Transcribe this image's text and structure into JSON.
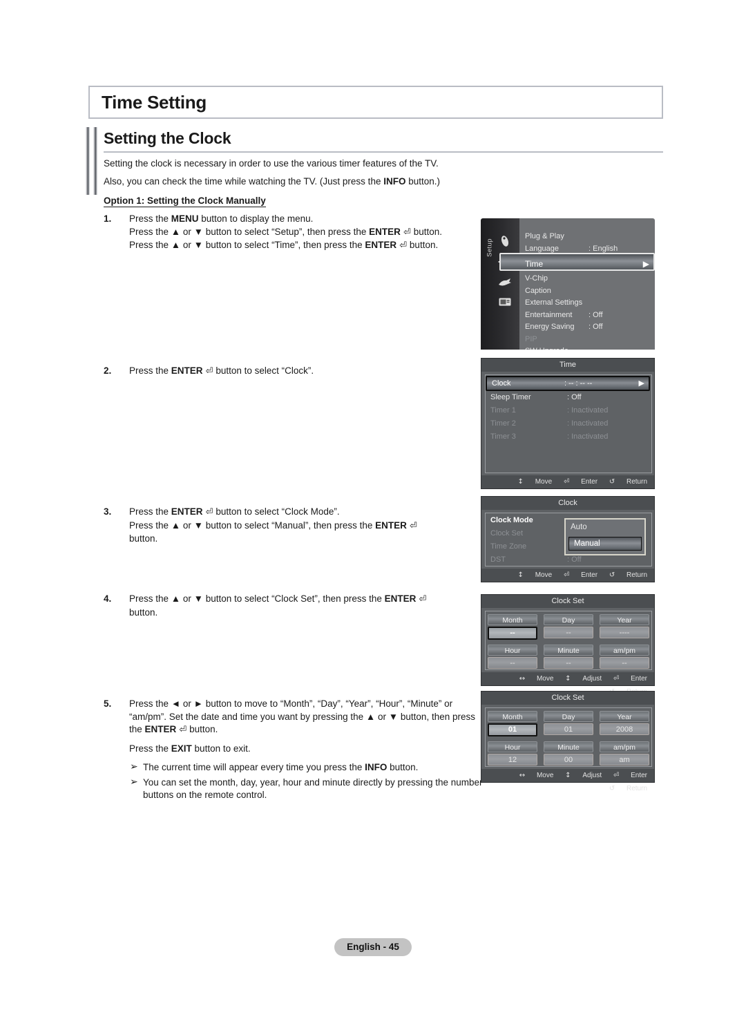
{
  "page": {
    "chapter_title": "Time Setting",
    "section_title": "Setting the Clock",
    "intro_line1": "Setting the clock is necessary in order to use the various timer features of the TV.",
    "intro_line2_a": "Also, you can check the time while watching the TV. (Just press the ",
    "intro_line2_b": "INFO",
    "intro_line2_c": " button.)",
    "option_heading": "Option 1: Setting the Clock Manually",
    "footer": "English - 45"
  },
  "steps": {
    "s1": {
      "num": "1.",
      "l1_a": "Press the ",
      "l1_b": "MENU",
      "l1_c": " button to display the menu.",
      "l2_a": "Press the ▲ or ▼ button to select “Setup”, then press the ",
      "l2_b": "ENTER",
      "l2_c": " button.",
      "l3_a": "Press the ▲ or ▼ button to select “Time”, then press the ",
      "l3_b": "ENTER",
      "l3_c": " button."
    },
    "s2": {
      "num": "2.",
      "l1_a": "Press the ",
      "l1_b": "ENTER",
      "l1_c": " button to select “Clock”."
    },
    "s3": {
      "num": "3.",
      "l1_a": "Press the ",
      "l1_b": "ENTER",
      "l1_c": " button to select “Clock Mode”.",
      "l2_a": "Press the ▲ or ▼ button to select “Manual”, then press the ",
      "l2_b": "ENTER",
      "l3": "button."
    },
    "s4": {
      "num": "4.",
      "l1_a": "Press the ▲ or ▼ button to select “Clock Set”, then press the ",
      "l1_b": "ENTER",
      "l2": "button."
    },
    "s5": {
      "num": "5.",
      "l1": "Press the ◄ or ► button to move to “Month”, “Day”, “Year”, “Hour”, “Minute” or “am/pm”. Set the date and time you want by pressing the ▲ or ▼ button, then press the ",
      "l1_b": "ENTER",
      "l1_c": " button.",
      "l2_a": "Press the ",
      "l2_b": "EXIT",
      "l2_c": " button to exit.",
      "bullet1_a": "The current time will appear every time you press the ",
      "bullet1_b": "INFO",
      "bullet1_c": " button.",
      "bullet2": "You can set the month, day, year, hour and minute directly by pressing the number buttons on the remote control.",
      "bullet_glyph": "➢"
    }
  },
  "osd": {
    "setup_menu": {
      "rail_label": "Setup",
      "items": [
        {
          "label": "Plug & Play",
          "value": "",
          "state": "normal"
        },
        {
          "label": "Language",
          "value": ": English",
          "state": "normal"
        },
        {
          "label": "Time",
          "value": "",
          "state": "selected",
          "caret": "▶"
        },
        {
          "label": "V-Chip",
          "value": "",
          "state": "normal"
        },
        {
          "label": "Caption",
          "value": "",
          "state": "normal"
        },
        {
          "label": "External Settings",
          "value": "",
          "state": "normal"
        },
        {
          "label": "Entertainment",
          "value": ": Off",
          "state": "normal"
        },
        {
          "label": "Energy Saving",
          "value": ": Off",
          "state": "normal"
        },
        {
          "label": "PIP",
          "value": "",
          "state": "dim"
        },
        {
          "label": "SW Upgrade",
          "value": "",
          "state": "normal"
        }
      ]
    },
    "time_menu": {
      "header": "Time",
      "rows": [
        {
          "label": "Clock",
          "value": ": -- : -- --",
          "state": "selected",
          "caret": "▶"
        },
        {
          "label": "Sleep Timer",
          "value": ": Off",
          "state": "normal"
        },
        {
          "label": "Timer 1",
          "value": ": Inactivated",
          "state": "dim"
        },
        {
          "label": "Timer 2",
          "value": ": Inactivated",
          "state": "dim"
        },
        {
          "label": "Timer 3",
          "value": ": Inactivated",
          "state": "dim"
        }
      ],
      "footer": [
        {
          "icon": "↕",
          "label": "Move"
        },
        {
          "icon": "⏎",
          "label": "Enter"
        },
        {
          "icon": "↺",
          "label": "Return"
        }
      ]
    },
    "clock_menu": {
      "header": "Clock",
      "rows": [
        {
          "label": "Clock Mode",
          "value": ":",
          "state": "normal"
        },
        {
          "label": "Clock Set",
          "value": "",
          "state": "dim"
        },
        {
          "label": "Time Zone",
          "value": "",
          "state": "dim"
        },
        {
          "label": "DST",
          "value": ": Off",
          "state": "dim"
        }
      ],
      "dropdown": {
        "options": [
          "Auto",
          "Manual"
        ],
        "selected": "Manual"
      },
      "footer": [
        {
          "icon": "↕",
          "label": "Move"
        },
        {
          "icon": "⏎",
          "label": "Enter"
        },
        {
          "icon": "↺",
          "label": "Return"
        }
      ]
    },
    "clock_set_empty": {
      "header": "Clock Set",
      "fields": [
        {
          "label": "Month",
          "value": "--",
          "focused": true
        },
        {
          "label": "Day",
          "value": "--",
          "focused": false
        },
        {
          "label": "Year",
          "value": "----",
          "focused": false
        },
        {
          "label": "Hour",
          "value": "--",
          "focused": false
        },
        {
          "label": "Minute",
          "value": "--",
          "focused": false
        },
        {
          "label": "am/pm",
          "value": "--",
          "focused": false
        }
      ],
      "footer": [
        {
          "icon": "↔",
          "label": "Move"
        },
        {
          "icon": "↕",
          "label": "Adjust"
        },
        {
          "icon": "⏎",
          "label": "Enter"
        },
        {
          "icon": "↺",
          "label": "Return"
        }
      ]
    },
    "clock_set_filled": {
      "header": "Clock Set",
      "fields": [
        {
          "label": "Month",
          "value": "01",
          "focused": true
        },
        {
          "label": "Day",
          "value": "01",
          "focused": false
        },
        {
          "label": "Year",
          "value": "2008",
          "focused": false
        },
        {
          "label": "Hour",
          "value": "12",
          "focused": false
        },
        {
          "label": "Minute",
          "value": "00",
          "focused": false
        },
        {
          "label": "am/pm",
          "value": "am",
          "focused": false
        }
      ],
      "footer": [
        {
          "icon": "↔",
          "label": "Move"
        },
        {
          "icon": "↕",
          "label": "Adjust"
        },
        {
          "icon": "⏎",
          "label": "Enter"
        },
        {
          "icon": "↺",
          "label": "Return"
        }
      ]
    }
  }
}
